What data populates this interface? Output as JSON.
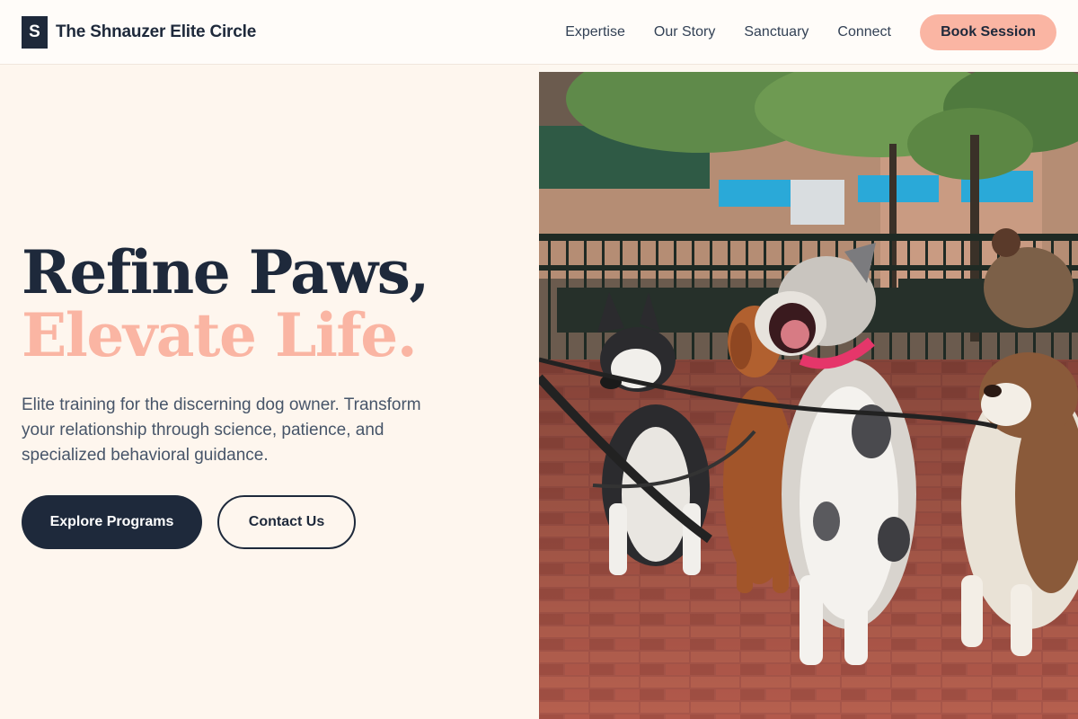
{
  "header": {
    "logo_letter": "S",
    "brand_name": "The Shnauzer Elite Circle",
    "nav": [
      "Expertise",
      "Our Story",
      "Sanctuary",
      "Connect"
    ],
    "cta_label": "Book Session"
  },
  "hero": {
    "headline_line1": "Refine Paws,",
    "headline_line2": "Elevate Life.",
    "subtext": "Elite training for the discerning dog owner. Transform your relationship through science, patience, and specialized behavioral guidance.",
    "primary_button": "Explore Programs",
    "secondary_button": "Contact Us"
  },
  "colors": {
    "navy": "#1e293b",
    "accent_peach": "#fab5a3",
    "background": "#fef6ee"
  },
  "image": {
    "subject": "dogs-on-leashes-photo"
  }
}
